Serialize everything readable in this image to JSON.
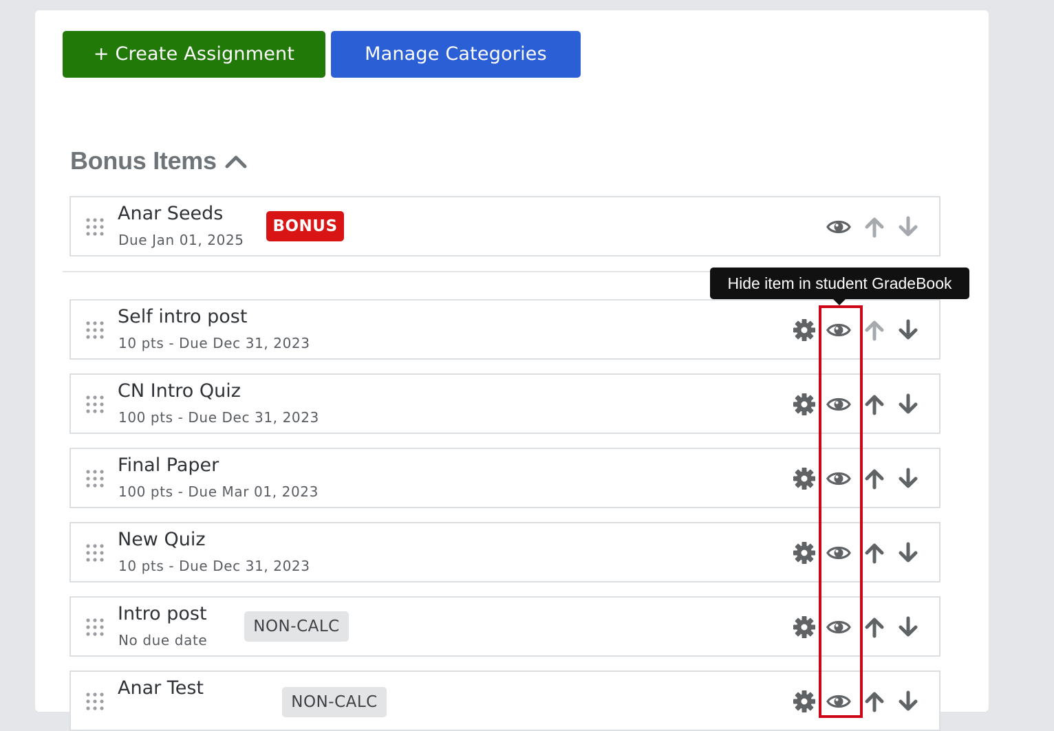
{
  "toolbar": {
    "create_label": "+ Create Assignment",
    "manage_label": "Manage Categories",
    "create_color": "#217a07",
    "manage_color": "#2b5fd6"
  },
  "section": {
    "title": "Bonus Items",
    "collapse_icon": "chevron-up-icon"
  },
  "tooltip": {
    "text": "Hide item in student GradeBook"
  },
  "icons": {
    "drag": "drag-handle-icon",
    "settings": "gear-icon",
    "visibility": "eye-icon",
    "move_up": "arrow-up-icon",
    "move_down": "arrow-down-icon"
  },
  "bonus_items": [
    {
      "title": "Anar Seeds",
      "meta": "Due Jan 01, 2025",
      "badge": "BONUS",
      "badge_color": "#d91414"
    }
  ],
  "assignments": [
    {
      "title": "Self intro post",
      "meta": "10 pts - Due Dec 31, 2023",
      "up_disabled": true
    },
    {
      "title": "CN Intro Quiz",
      "meta": "100 pts - Due Dec 31, 2023"
    },
    {
      "title": "Final Paper",
      "meta": "100 pts - Due Mar 01, 2023"
    },
    {
      "title": "New Quiz",
      "meta": "10 pts - Due Dec 31, 2023"
    },
    {
      "title": "Intro post",
      "meta": "No due date",
      "badge": "NON-CALC"
    },
    {
      "title": "Anar Test",
      "meta": "",
      "badge": "NON-CALC"
    }
  ],
  "colors": {
    "icon_active": "#606366",
    "icon_disabled": "#a6a9ad",
    "highlight": "#cc0616"
  }
}
